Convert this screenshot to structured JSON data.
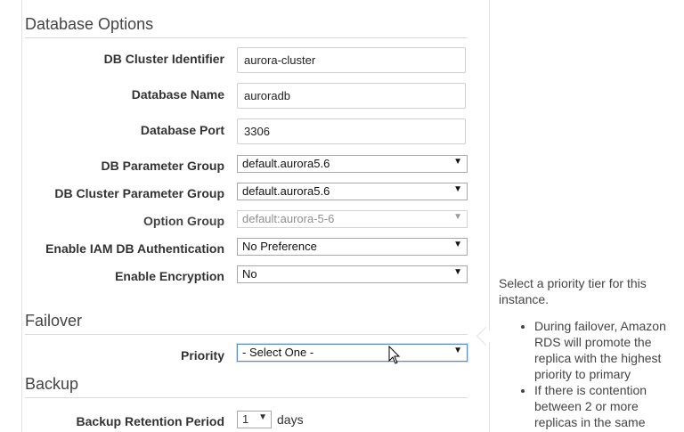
{
  "sections": {
    "database_options": "Database Options",
    "failover": "Failover",
    "backup": "Backup"
  },
  "fields": {
    "cluster_identifier": {
      "label": "DB Cluster Identifier",
      "value": "aurora-cluster"
    },
    "database_name": {
      "label": "Database Name",
      "value": "auroradb"
    },
    "database_port": {
      "label": "Database Port",
      "value": "3306"
    },
    "parameter_group": {
      "label": "DB Parameter Group",
      "value": "default.aurora5.6"
    },
    "cluster_parameter_group": {
      "label": "DB Cluster Parameter Group",
      "value": "default.aurora5.6"
    },
    "option_group": {
      "label": "Option Group",
      "value": "default:aurora-5-6"
    },
    "iam_auth": {
      "label": "Enable IAM DB Authentication",
      "value": "No Preference"
    },
    "encryption": {
      "label": "Enable Encryption",
      "value": "No"
    },
    "priority": {
      "label": "Priority",
      "value": "- Select One -"
    },
    "backup_retention": {
      "label": "Backup Retention Period",
      "value": "1",
      "suffix": "days"
    }
  },
  "help": {
    "intro": "Select a priority tier for this instance.",
    "bullets": [
      "During failover, Amazon RDS will promote the replica with the highest priority to primary",
      "If there is contention between 2 or more replicas in the same"
    ]
  },
  "icons": {
    "dropdown": "chevron-down-icon",
    "cursor": "mouse-pointer-icon"
  }
}
